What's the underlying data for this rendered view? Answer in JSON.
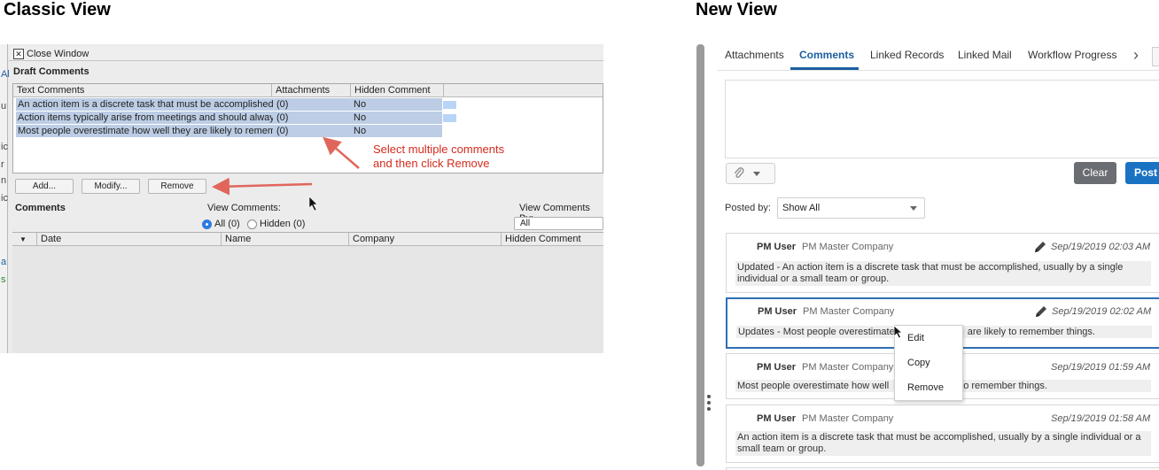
{
  "headings": {
    "classic": "Classic View",
    "new": "New View"
  },
  "classic": {
    "strip_letters": [
      "Al",
      "u",
      "ic",
      "r",
      "n",
      "ic",
      "a",
      "s"
    ],
    "close_window": "Close Window",
    "draft_title": "Draft Comments",
    "draft_columns": [
      "Text Comments",
      "Attachments",
      "Hidden Comment"
    ],
    "draft_rows": [
      {
        "text": "An action item is a discrete task that must be accomplished, usua",
        "attachments": "(0)",
        "hidden": "No"
      },
      {
        "text": "Action items typically arise from meetings and should always be c",
        "attachments": "(0)",
        "hidden": "No"
      },
      {
        "text": "Most people overestimate how well they are likely to remember tl",
        "attachments": "(0)",
        "hidden": "No"
      }
    ],
    "annotation": [
      "Select multiple comments",
      "and then click Remove"
    ],
    "buttons": {
      "add": "Add...",
      "modify": "Modify...",
      "remove": "Remove"
    },
    "comments_title": "Comments",
    "view_comments_label": "View Comments:",
    "radio_all": "All (0)",
    "radio_hidden": "Hidden (0)",
    "view_by_label": "View Comments By:",
    "view_by_value": "All",
    "grid_columns": [
      "Date",
      "Name",
      "Company",
      "Hidden Comment"
    ],
    "colors": {
      "annotation": "#d42b1e",
      "selection": "#bccde5"
    }
  },
  "new": {
    "tabs": [
      "Attachments",
      "Comments",
      "Linked Records",
      "Linked Mail",
      "Workflow Progress"
    ],
    "active_tab": "Comments",
    "clear_label": "Clear",
    "post_label": "Post",
    "posted_by_label": "Posted by:",
    "posted_by_value": "Show All",
    "comments": [
      {
        "author": "PM User",
        "company": "PM Master Company",
        "date": "Sep/19/2019 02:03 AM",
        "lines": [
          "Updated - An action item is a discrete task that must be accomplished, usually by a single",
          "individual or a small team or group."
        ],
        "editable": true
      },
      {
        "author": "PM User",
        "company": "PM Master Company",
        "date": "Sep/19/2019 02:02 AM",
        "lines": [
          "Updates - Most people overestimate",
          "are likely to remember things."
        ],
        "editable": true
      },
      {
        "author": "PM User",
        "company": "PM Master Company",
        "date": "Sep/19/2019 01:59 AM",
        "lines": [
          "Most people overestimate how well",
          "o remember things."
        ],
        "editable": false
      },
      {
        "author": "PM User",
        "company": "PM Master Company",
        "date": "Sep/19/2019 01:58 AM",
        "lines": [
          "An action item is a discrete task that must be accomplished, usually by a single individual or a",
          "small team or group."
        ],
        "editable": false
      }
    ],
    "context_menu": [
      "Edit",
      "Copy",
      "Remove"
    ],
    "colors": {
      "accent": "#1c5fa0",
      "post": "#1a72c3",
      "clear": "#6a6d72",
      "selected_border": "#2f6fb4"
    }
  }
}
